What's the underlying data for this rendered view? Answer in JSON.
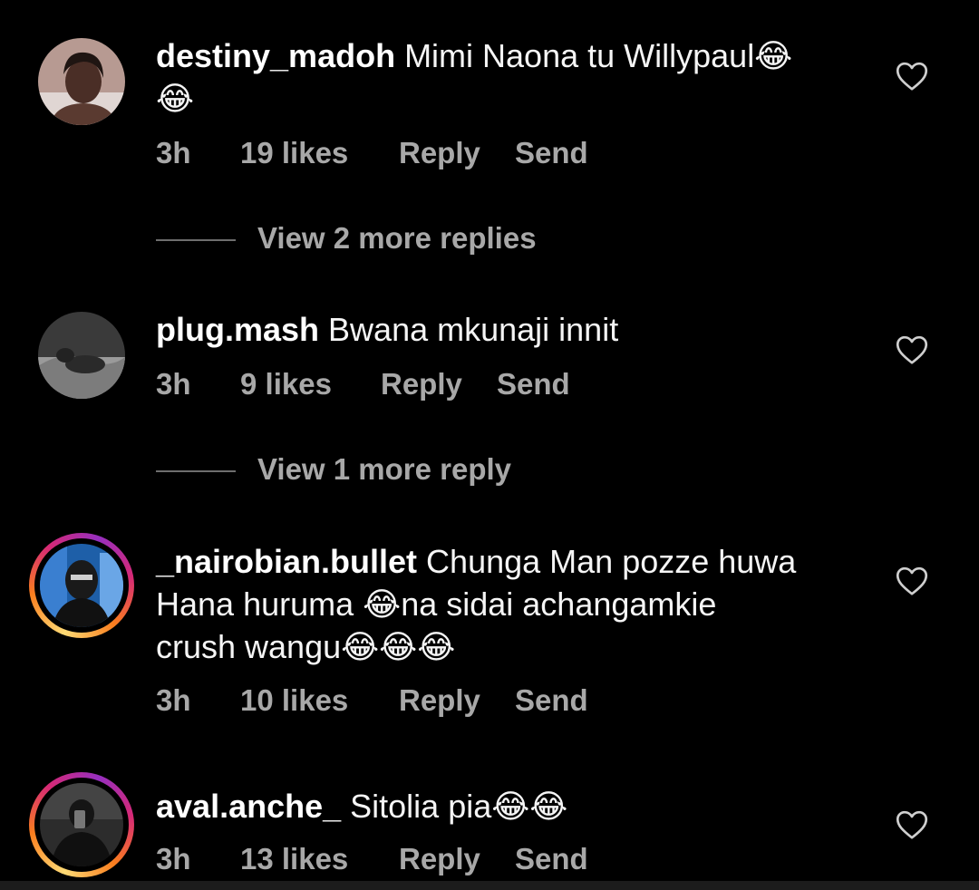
{
  "comments": [
    {
      "username": "destiny_madoh",
      "text": " Mimi Naona tu Willypaul😂",
      "text2": "😂",
      "time": "3h",
      "likes": "19 likes",
      "reply": "Reply",
      "send": "Send",
      "view_replies": "View 2 more replies"
    },
    {
      "username": "plug.mash",
      "text": " Bwana mkunaji innit",
      "time": "3h",
      "likes": "9 likes",
      "reply": "Reply",
      "send": "Send",
      "view_replies": "View 1 more reply"
    },
    {
      "username": "_nairobian.bullet",
      "text": " Chunga Man pozze huwa",
      "text2": "Hana huruma 😂na sidai achangamkie",
      "text3": "crush wangu😂😂😂",
      "time": "3h",
      "likes": "10 likes",
      "reply": "Reply",
      "send": "Send"
    },
    {
      "username": "aval.anche_",
      "text": " Sitolia pia😂😂",
      "time": "3h",
      "likes": "13 likes",
      "reply": "Reply",
      "send": "Send"
    }
  ],
  "icons": {
    "like": "heart-outline-icon"
  },
  "colors": {
    "background": "#000000",
    "meta_text": "#a8a8a8",
    "story_ring": "#d62976"
  }
}
